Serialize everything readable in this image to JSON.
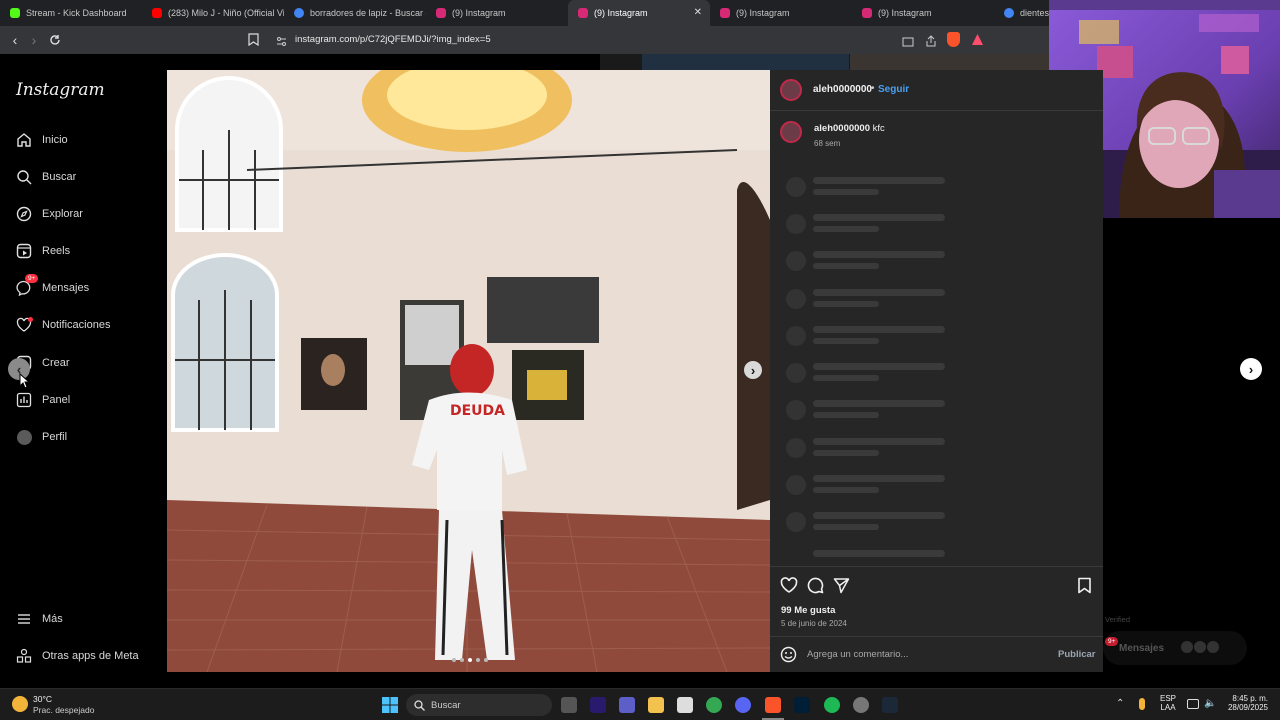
{
  "tabs": [
    {
      "label": "Stream - Kick Dashboard",
      "color": "#53fc18"
    },
    {
      "label": "(283) Milo J - Niño (Official Vid",
      "color": "#ff0000"
    },
    {
      "label": "borradores de lapiz - Buscar co",
      "color": "#4285f4"
    },
    {
      "label": "(9) Instagram",
      "color": "#d62976"
    },
    {
      "label": "(9) Instagram",
      "color": "#d62976",
      "active": true
    },
    {
      "label": "(9) Instagram",
      "color": "#d62976"
    },
    {
      "label": "(9) Instagram",
      "color": "#d62976"
    },
    {
      "label": "dientes",
      "color": "#4285f4"
    }
  ],
  "address": {
    "url": "instagram.com/p/C72jQFEMDJi/?img_index=5"
  },
  "sidebar": {
    "logo": "Instagram",
    "items": [
      {
        "label": "Inicio",
        "icon": "home-icon"
      },
      {
        "label": "Buscar",
        "icon": "search-icon"
      },
      {
        "label": "Explorar",
        "icon": "compass-icon"
      },
      {
        "label": "Reels",
        "icon": "reels-icon"
      },
      {
        "label": "Mensajes",
        "icon": "messenger-icon",
        "badge": "9+"
      },
      {
        "label": "Notificaciones",
        "icon": "heart-icon"
      },
      {
        "label": "Crear",
        "icon": "plus-square-icon"
      },
      {
        "label": "Panel",
        "icon": "chart-icon"
      },
      {
        "label": "Perfil",
        "icon": "avatar-icon"
      }
    ],
    "more": "Más",
    "meta": "Otras apps de Meta"
  },
  "post": {
    "username": "aleh0000000",
    "follow": "Seguir",
    "caption_user": "aleh0000000",
    "caption_text": "kfc",
    "caption_age": "68 sem",
    "likes": "99 Me gusta",
    "date": "5 de junio de 2024",
    "comment_placeholder": "Agrega un comentario...",
    "publish": "Publicar",
    "photo_text": "DEUDA"
  },
  "messages_float": {
    "label": "Mensajes",
    "badge": "9+",
    "verified": "Verified"
  },
  "taskbar": {
    "weather_temp": "30°C",
    "weather_desc": "Prac. despejado",
    "search_label": "Buscar",
    "lang1": "ESP",
    "lang2": "LAA",
    "time": "8:45 p. m.",
    "date": "28/09/2025"
  }
}
